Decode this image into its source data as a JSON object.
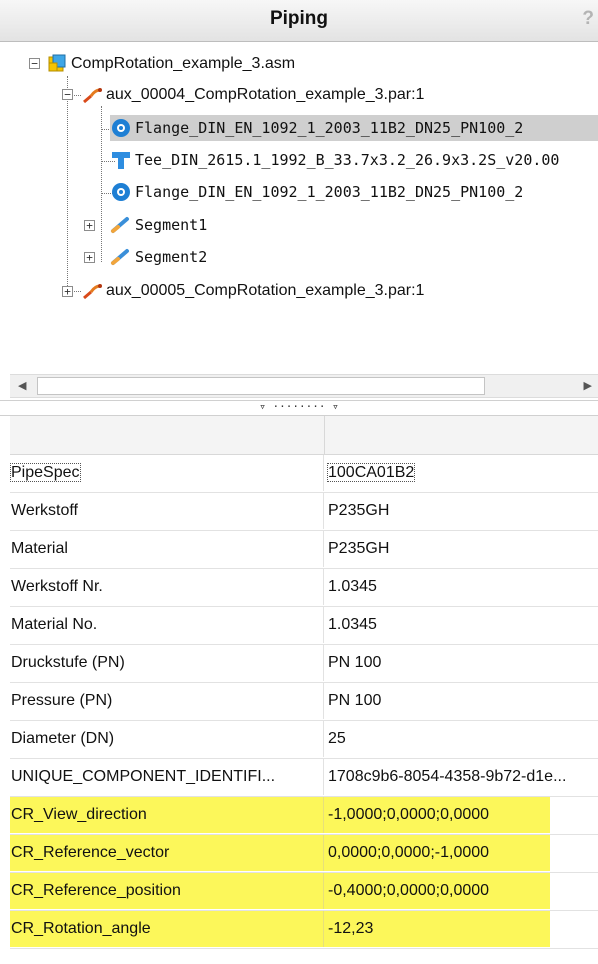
{
  "window": {
    "title": "Piping",
    "help_glyph": "?"
  },
  "tree": {
    "nodes": [
      {
        "label": "CompRotation_example_3.asm",
        "icon": "assembly-icon"
      },
      {
        "label": "aux_00004_CompRotation_example_3.par:1",
        "icon": "pipe-part-icon"
      },
      {
        "label": "Flange_DIN_EN_1092_1_2003_11B2_DN25_PN100_2",
        "icon": "flange-icon",
        "selected": true
      },
      {
        "label": "Tee_DIN_2615.1_1992_B_33.7x3.2_26.9x3.2S_v20.00",
        "icon": "tee-icon"
      },
      {
        "label": "Flange_DIN_EN_1092_1_2003_11B2_DN25_PN100_2",
        "icon": "flange-icon"
      },
      {
        "label": "Segment1",
        "icon": "segment-icon"
      },
      {
        "label": "Segment2",
        "icon": "segment-icon"
      },
      {
        "label": "aux_00005_CompRotation_example_3.par:1",
        "icon": "pipe-part-icon"
      }
    ]
  },
  "splitter_glyph": "▿ ········ ▿",
  "properties": {
    "rows": [
      {
        "name": "PipeSpec",
        "value": "100CA01B2"
      },
      {
        "name": "Werkstoff",
        "value": "P235GH"
      },
      {
        "name": "Material",
        "value": "P235GH"
      },
      {
        "name": "Werkstoff Nr.",
        "value": "1.0345"
      },
      {
        "name": "Material No.",
        "value": "1.0345"
      },
      {
        "name": "Druckstufe (PN)",
        "value": "PN 100"
      },
      {
        "name": "Pressure (PN)",
        "value": "PN 100"
      },
      {
        "name": "Diameter (DN)",
        "value": "25"
      },
      {
        "name": "UNIQUE_COMPONENT_IDENTIFI...",
        "value": "1708c9b6-8054-4358-9b72-d1e..."
      },
      {
        "name": "CR_View_direction",
        "value": "-1,0000;0,0000;0,0000"
      },
      {
        "name": "CR_Reference_vector",
        "value": "0,0000;0,0000;-1,0000"
      },
      {
        "name": "CR_Reference_position",
        "value": "-0,4000;0,0000;0,0000"
      },
      {
        "name": "CR_Rotation_angle",
        "value": "-12,23"
      }
    ]
  },
  "colors": {
    "highlight": "#fcf75a",
    "selection": "#cfcfcf",
    "flange_blue": "#1e7fd4",
    "part_orange": "#e57b1f"
  }
}
